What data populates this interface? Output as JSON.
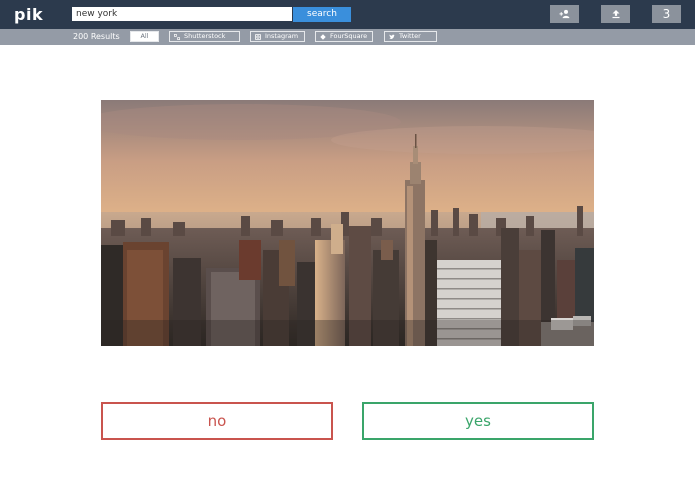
{
  "app": {
    "logo": "pik"
  },
  "search": {
    "value": "new york",
    "button_label": "search"
  },
  "top_actions": {
    "notification_count": "3"
  },
  "filters": {
    "results_label": "200 Results",
    "sources": [
      {
        "label": "All",
        "icon": "none",
        "active": true
      },
      {
        "label": "Shutterstock",
        "icon": "shutterstock-icon",
        "active": false
      },
      {
        "label": "Instagram",
        "icon": "instagram-icon",
        "active": false
      },
      {
        "label": "FourSquare",
        "icon": "foursquare-icon",
        "active": false
      },
      {
        "label": "Twitter",
        "icon": "twitter-icon",
        "active": false
      }
    ]
  },
  "image": {
    "subject": "new york skyline at sunset"
  },
  "answers": {
    "no_label": "no",
    "yes_label": "yes"
  },
  "colors": {
    "topbar": "#2c3a4d",
    "filterbar": "#949ba6",
    "search_button": "#3a8fdc",
    "no": "#c9544e",
    "yes": "#3aa56a"
  }
}
